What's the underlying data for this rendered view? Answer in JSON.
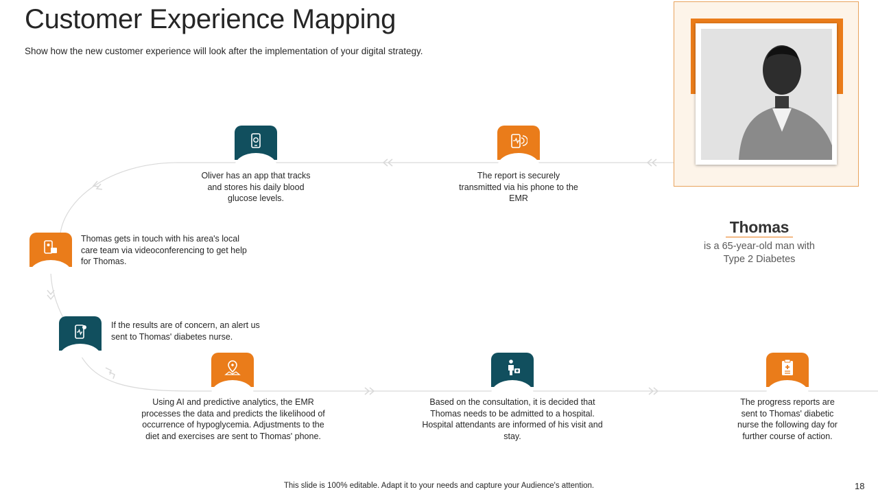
{
  "slide": {
    "title": "Customer Experience Mapping",
    "subtitle": "Show how the new customer  experience will look after the implementation of your digital strategy."
  },
  "colors": {
    "teal": "#114f5e",
    "orange": "#ea7c1a",
    "flow_line": "#d9d9d9"
  },
  "steps": [
    {
      "icon": "smartphone-app-icon",
      "color": "teal",
      "text": "Oliver has an app that tracks and stores his daily blood glucose levels."
    },
    {
      "icon": "phone-transmit-icon",
      "color": "orange",
      "text": "The report is securely transmitted via his phone to the EMR"
    },
    {
      "icon": "video-call-icon",
      "color": "orange",
      "text": "Thomas gets in touch with his area's local care team via videoconferencing to get help for Thomas."
    },
    {
      "icon": "mobile-alert-icon",
      "color": "teal",
      "text": "If the results are of concern, an alert us sent to Thomas' diabetes nurse."
    },
    {
      "icon": "location-map-icon",
      "color": "orange",
      "text": "Using AI and predictive analytics, the EMR processes the data and predicts the likelihood of occurrence of hypoglycemia. Adjustments to the diet and exercises are sent to Thomas' phone."
    },
    {
      "icon": "patient-medkit-icon",
      "color": "teal",
      "text": "Based on the consultation, it is decided that Thomas needs to be admitted to a hospital. Hospital attendants are informed of his visit and stay."
    },
    {
      "icon": "medical-report-icon",
      "color": "orange",
      "text": "The progress reports are sent to Thomas' diabetic nurse the following day for further course of action."
    }
  ],
  "persona": {
    "name": "Thomas",
    "description": "is a 65-year-old man with Type 2 Diabetes",
    "photo_icon": "person-portrait-icon"
  },
  "footer": {
    "note": "This slide is 100% editable. Adapt it to your needs and capture your Audience's attention.",
    "page_number": "18"
  }
}
